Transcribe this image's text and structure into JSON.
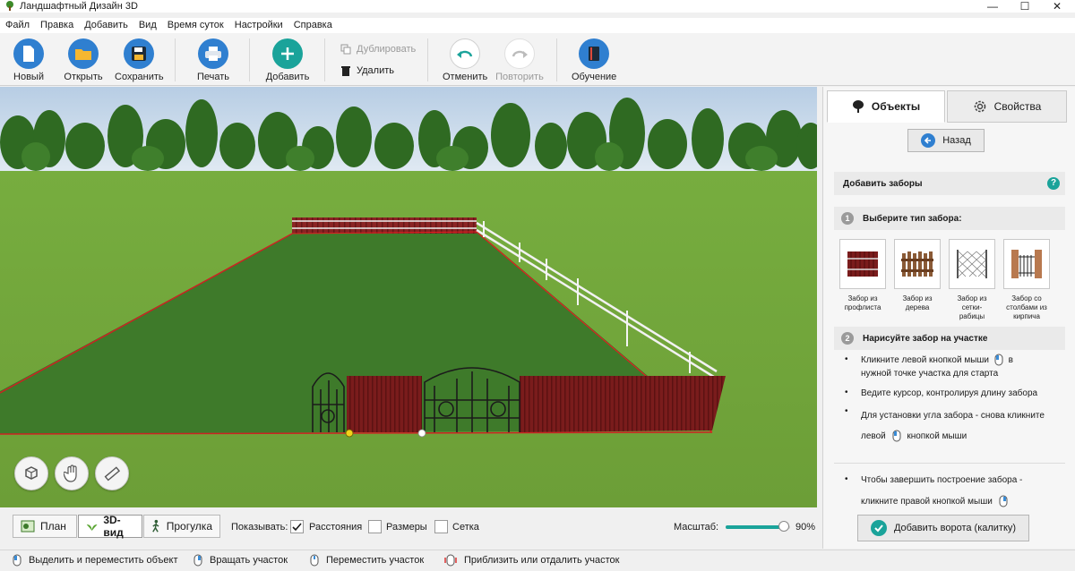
{
  "window": {
    "title": "Ландшафтный Дизайн 3D",
    "minimize": "—",
    "maximize": "☐",
    "close": "✕"
  },
  "menu": [
    "Файл",
    "Правка",
    "Добавить",
    "Вид",
    "Время суток",
    "Настройки",
    "Справка"
  ],
  "toolbar": {
    "new": "Новый",
    "open": "Открыть",
    "save": "Сохранить",
    "print": "Печать",
    "add": "Добавить",
    "duplicate": "Дублировать",
    "delete": "Удалить",
    "undo": "Отменить",
    "redo": "Повторить",
    "learn": "Обучение"
  },
  "view": {
    "plan": "План",
    "view3d": "3D-вид",
    "walk": "Прогулка"
  },
  "show": {
    "label": "Показывать:",
    "distances": "Расстояния",
    "sizes": "Размеры",
    "grid": "Сетка",
    "distances_checked": true,
    "sizes_checked": false,
    "grid_checked": false
  },
  "zoom": {
    "label": "Масштаб:",
    "value": "90%",
    "level": 0.9
  },
  "status": [
    "Выделить и переместить объект",
    "Вращать участок",
    "Переместить участок",
    "Приблизить или отдалить участок"
  ],
  "panel": {
    "tab_objects": "Объекты",
    "tab_properties": "Свойства",
    "back": "Назад",
    "section_title": "Добавить заборы",
    "help": "?",
    "step1_num": "1",
    "step1": "Выберите тип забора:",
    "fences": [
      {
        "l1": "Забор из",
        "l2": "профлиста",
        "l3": ""
      },
      {
        "l1": "Забор из",
        "l2": "дерева",
        "l3": ""
      },
      {
        "l1": "Забор из",
        "l2": "сетки-",
        "l3": "рабицы"
      },
      {
        "l1": "Забор со",
        "l2": "столбами из",
        "l3": "кирпича"
      }
    ],
    "step2_num": "2",
    "step2": "Нарисуйте забор на участке",
    "b1a": "Кликните левой кнопкой мыши",
    "b1b": "в",
    "b1c": "нужной точке участка для старта",
    "b2": "Ведите курсор, контролируя длину забора",
    "b3a": "Для установки угла забора - снова кликните",
    "b3b": "левой",
    "b3c": "кнопкой мыши",
    "finish1": "Чтобы завершить построение забора -",
    "finish2": "кликните правой кнопкой мыши",
    "add_gate": "Добавить ворота (калитку)"
  },
  "colors": {
    "accent_teal": "#1aa39a",
    "fence_red": "#7a1c1c",
    "grass": "#4d8a2e",
    "sky": "#c7d9ea"
  }
}
